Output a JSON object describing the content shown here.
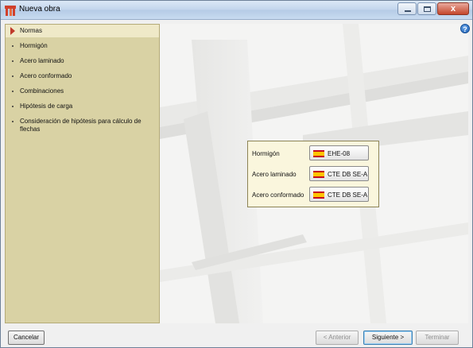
{
  "window": {
    "title": "Nueva obra",
    "help_glyph": "?",
    "close_glyph": "x"
  },
  "sidebar": {
    "items": [
      {
        "label": "Normas",
        "active": true
      },
      {
        "label": "Hormigón",
        "active": false
      },
      {
        "label": "Acero laminado",
        "active": false
      },
      {
        "label": "Acero conformado",
        "active": false
      },
      {
        "label": "Combinaciones",
        "active": false
      },
      {
        "label": "Hipótesis de carga",
        "active": false
      },
      {
        "label": "Consideración de hipótesis para cálculo de flechas",
        "active": false
      }
    ]
  },
  "norms": {
    "rows": [
      {
        "label": "Hormigón",
        "value": "EHE-08",
        "flag": "spain-flag-icon"
      },
      {
        "label": "Acero laminado",
        "value": "CTE DB SE-A",
        "flag": "spain-flag-icon"
      },
      {
        "label": "Acero conformado",
        "value": "CTE DB SE-A",
        "flag": "spain-flag-icon"
      }
    ]
  },
  "footer": {
    "cancel": "Cancelar",
    "previous": "< Anterior",
    "next": "Siguiente >",
    "finish": "Terminar"
  },
  "colors": {
    "sidebar_bg": "#d9d2a4",
    "panel_bg": "#faf6dd",
    "active_marker": "#c0392b"
  }
}
